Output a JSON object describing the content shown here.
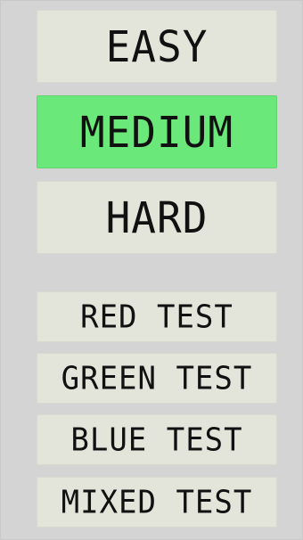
{
  "difficulty": {
    "selected": "MEDIUM",
    "easy_label": "EASY",
    "medium_label": "MEDIUM",
    "hard_label": "HARD"
  },
  "tests": {
    "red_label": "RED TEST",
    "green_label": "GREEN TEST",
    "blue_label": "BLUE TEST",
    "mixed_label": "MIXED TEST"
  },
  "colors": {
    "background": "#d4d4d4",
    "button": "#e3e5da",
    "selected": "#6be87a",
    "text": "#111111"
  }
}
